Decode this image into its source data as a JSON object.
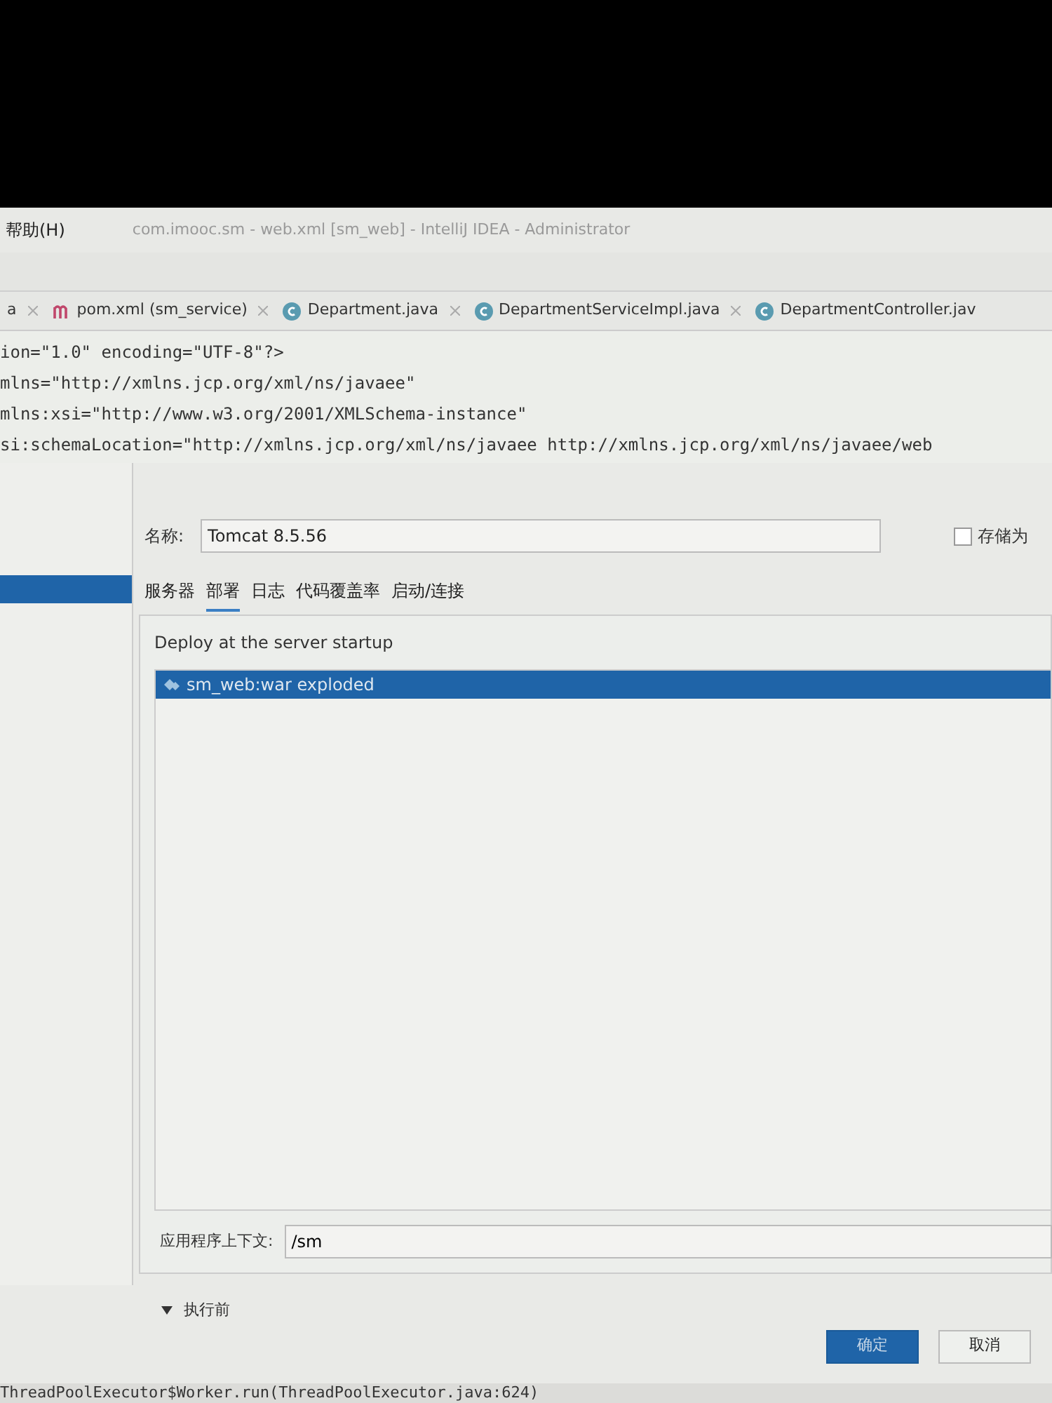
{
  "menu": {
    "label": "帮助(H)"
  },
  "window": {
    "title": "com.imooc.sm - web.xml [sm_web] - IntelliJ IDEA - Administrator"
  },
  "editor_tabs": [
    {
      "label": "a",
      "kind": "plain",
      "selected": false
    },
    {
      "label": "pom.xml (sm_service)",
      "kind": "maven",
      "selected": false
    },
    {
      "label": "Department.java",
      "kind": "class",
      "selected": false
    },
    {
      "label": "DepartmentServiceImpl.java",
      "kind": "class",
      "selected": false
    },
    {
      "label": "DepartmentController.jav",
      "kind": "class",
      "selected": false
    }
  ],
  "code_lines": [
    "ion=\"1.0\" encoding=\"UTF-8\"?>",
    "mlns=\"http://xmlns.jcp.org/xml/ns/javaee\"",
    "mlns:xsi=\"http://www.w3.org/2001/XMLSchema-instance\"",
    "si:schemaLocation=\"http://xmlns.jcp.org/xml/ns/javaee http://xmlns.jcp.org/xml/ns/javaee/web"
  ],
  "dialog": {
    "name_label": "名称:",
    "name_value": "Tomcat 8.5.56",
    "store_checkbox": {
      "label": "存储为",
      "checked": false
    },
    "tabs": [
      {
        "label": "服务器",
        "selected": false
      },
      {
        "label": "部署",
        "selected": true
      },
      {
        "label": "日志",
        "selected": false
      },
      {
        "label": "代码覆盖率",
        "selected": false
      },
      {
        "label": "启动/连接",
        "selected": false
      }
    ],
    "deploy_title": "Deploy at the server startup",
    "artifacts": [
      {
        "label": "sm_web:war exploded",
        "selected": true
      }
    ],
    "context_label": "应用程序上下文:",
    "context_value": "/sm",
    "before_launch": {
      "label": "执行前",
      "expanded": true
    },
    "buttons": [
      {
        "label": "确定",
        "kind": "primary"
      },
      {
        "label": "取消",
        "kind": "secondary"
      }
    ]
  },
  "console_line": "ThreadPoolExecutor$Worker.run(ThreadPoolExecutor.java:624)"
}
